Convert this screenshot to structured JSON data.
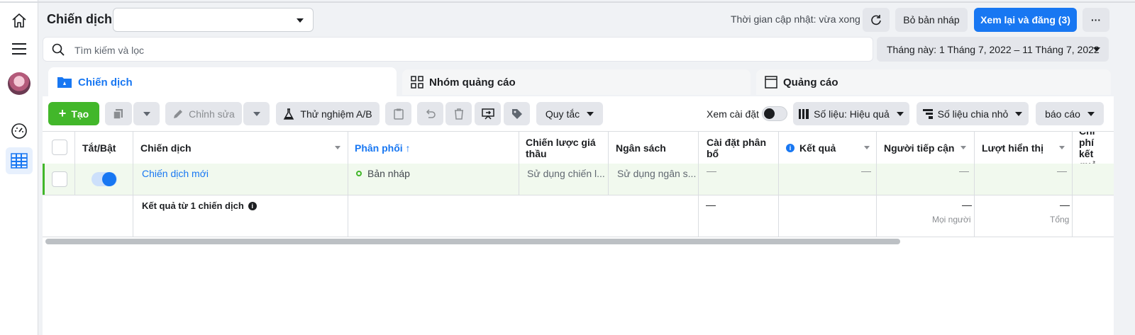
{
  "header": {
    "title": "Chiến dịch",
    "update_time": "Thời gian cập nhật: vừa xong",
    "discard_draft": "Bỏ bản nháp",
    "review_publish": "Xem lại và đăng (3)",
    "more": "···"
  },
  "search": {
    "placeholder": "Tìm kiếm và lọc",
    "date_range": "Tháng này: 1 Tháng 7, 2022 – 11 Tháng 7, 2022"
  },
  "tabs": [
    {
      "label": "Chiến dịch"
    },
    {
      "label": "Nhóm quảng cáo"
    },
    {
      "label": "Quảng cáo"
    }
  ],
  "toolbar": {
    "create": "Tạo",
    "edit": "Chỉnh sửa",
    "ab_test": "Thử nghiệm A/B",
    "rules": "Quy tắc",
    "view_settings": "Xem cài đặt",
    "metrics": "Số liệu: Hiệu quả",
    "breakdown": "Số liệu chia nhỏ",
    "report": "báo cáo"
  },
  "table": {
    "columns": [
      "Tắt/Bật",
      "Chiến dịch",
      "Phân phối ↑",
      "Chiến lược giá thầu",
      "Ngân sách",
      "Cài đặt phân bổ",
      "Kết quả",
      "Người tiếp cận",
      "Lượt hiển thị",
      "Chi phí kết quả"
    ],
    "row": {
      "name": "Chiến dịch mới",
      "delivery": "Bản nháp",
      "bid_strategy": "Sử dụng chiến l...",
      "budget": "Sử dụng ngân s...",
      "dash": "—",
      "on": true
    },
    "summary": {
      "label": "Kết quả từ 1 chiến dịch",
      "reach_note": "Mọi người",
      "impressions_note": "Tổng",
      "dash": "—"
    }
  },
  "colors": {
    "accent": "#1877f2",
    "create": "#42b72a",
    "row_highlight": "#f1f9ee"
  }
}
